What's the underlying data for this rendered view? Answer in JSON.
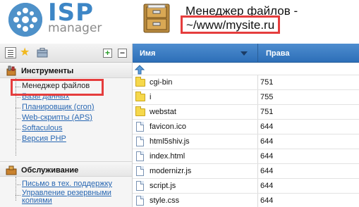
{
  "app": {
    "logo_brand": "ISP",
    "logo_sub": "manager",
    "title": "Менеджер файлов -",
    "path": "~/www/mysite.ru"
  },
  "colors": {
    "accent": "#3d86c6",
    "table_header": "#2d6fb8",
    "highlight": "#e53d3d",
    "folder": "#f6d84b"
  },
  "sidebar": {
    "toolbar": [
      {
        "icon": "list-view-icon"
      },
      {
        "icon": "favorites-star-icon"
      },
      {
        "icon": "briefcase-icon"
      },
      {
        "icon": "expand-all-icon",
        "label": "+"
      },
      {
        "icon": "collapse-all-icon",
        "label": "−"
      }
    ],
    "groups": [
      {
        "title": "Инструменты",
        "icon": "tools-icon",
        "items": [
          {
            "label": "Менеджер файлов",
            "active": true
          },
          {
            "label": "Базы данных"
          },
          {
            "label": "Планировщик (cron)"
          },
          {
            "label": "Web-скрипты (APS)"
          },
          {
            "label": "Softaculous"
          },
          {
            "label": "Версия PHP"
          }
        ]
      },
      {
        "title": "Обслуживание",
        "icon": "service-icon",
        "items": [
          {
            "label": "Письмо в тех. поддержку"
          },
          {
            "label": "Управление резервными копиями"
          }
        ]
      }
    ]
  },
  "table": {
    "columns": {
      "name": "Имя",
      "rights": "Права"
    },
    "up_icon": "up-folder-icon",
    "rows": [
      {
        "name": "cgi-bin",
        "rights": "751",
        "type": "folder"
      },
      {
        "name": "i",
        "rights": "755",
        "type": "folder"
      },
      {
        "name": "webstat",
        "rights": "751",
        "type": "folder"
      },
      {
        "name": "favicon.ico",
        "rights": "644",
        "type": "file"
      },
      {
        "name": "html5shiv.js",
        "rights": "644",
        "type": "file"
      },
      {
        "name": "index.html",
        "rights": "644",
        "type": "file"
      },
      {
        "name": "modernizr.js",
        "rights": "644",
        "type": "file"
      },
      {
        "name": "script.js",
        "rights": "644",
        "type": "file"
      },
      {
        "name": "style.css",
        "rights": "644",
        "type": "file"
      }
    ]
  }
}
